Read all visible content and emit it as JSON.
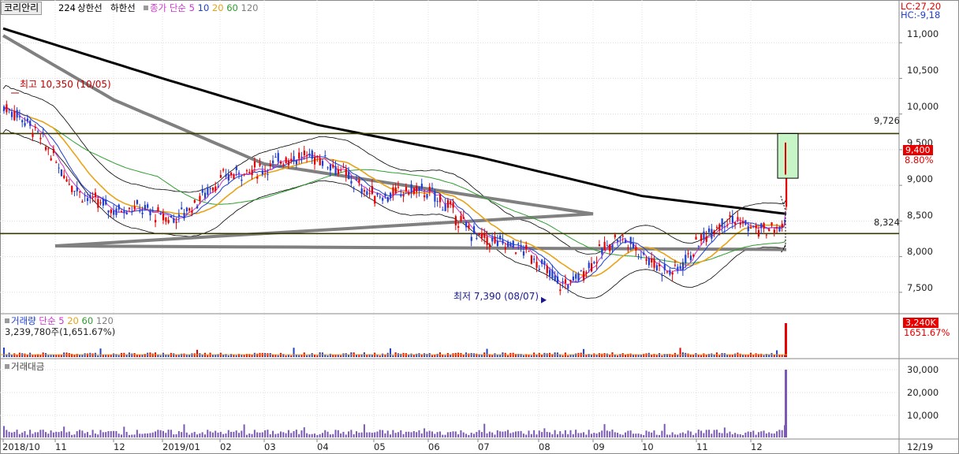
{
  "header": {
    "stock_name": "코리안리",
    "count": "224",
    "upper_limit": "상한선",
    "lower_limit": "하한선",
    "ma_prefix": "종가 단순",
    "ma_periods": [
      "5",
      "10",
      "20",
      "60",
      "120"
    ],
    "lc": "LC:27,20",
    "hc": "HC:-9,18"
  },
  "price_panel": {
    "high_label": "최고 10,350 (10/05)",
    "low_label": "최저 7,390 (08/07)",
    "resistance_label": "9,726",
    "support_label": "8,324",
    "current_price": "9,400",
    "current_change": "8.80%",
    "axis_ticks": [
      "11,000",
      "10,500",
      "10,000",
      "9,500",
      "9,000",
      "8,500",
      "8,000",
      "7,500"
    ]
  },
  "volume_panel": {
    "title": "거래량",
    "ma_prefix": "단순",
    "ma_periods": [
      "5",
      "20",
      "60",
      "120"
    ],
    "last_value": "3,239,780주(1,651.67%)",
    "current_badge": "3,240K",
    "current_pct": "1651.67%"
  },
  "amount_panel": {
    "title": "거래대금",
    "axis_ticks": [
      "30,000",
      "20,000",
      "10,000"
    ]
  },
  "x_axis": {
    "labels": [
      "2018/10",
      "11",
      "12",
      "2019/01",
      "02",
      "03",
      "04",
      "05",
      "06",
      "07",
      "08",
      "09",
      "10",
      "11",
      "12"
    ],
    "last_date": "12/19"
  },
  "colors": {
    "up": "#e60000",
    "down": "#1f3fcf",
    "ma5": "#cc33cc",
    "ma10": "#1f3fcf",
    "ma20": "#e8a317",
    "ma60": "#2e9e2e",
    "ma120": "#808080",
    "ma224": "#000000",
    "band": "#000000",
    "hline": "#3a3a00"
  },
  "chart_data": {
    "type": "candlestick",
    "period": "daily",
    "x_range": [
      "2018/10",
      "12/19"
    ],
    "ylim": [
      7200,
      11400
    ],
    "yticks": [
      7500,
      8000,
      8500,
      9000,
      9500,
      10000,
      10500,
      11000
    ],
    "grid": true,
    "close_series": [
      {
        "date": "2018/10",
        "close": 10100
      },
      {
        "date": "11",
        "close": 9300
      },
      {
        "date": "12",
        "close": 8550
      },
      {
        "date": "2019/01",
        "close": 8650
      },
      {
        "date": "02",
        "close": 9000
      },
      {
        "date": "03",
        "close": 9500
      },
      {
        "date": "04",
        "close": 9150
      },
      {
        "date": "05",
        "close": 8900
      },
      {
        "date": "06",
        "close": 8700
      },
      {
        "date": "07",
        "close": 8100
      },
      {
        "date": "08",
        "close": 7700
      },
      {
        "date": "09",
        "close": 8150
      },
      {
        "date": "10",
        "close": 7900
      },
      {
        "date": "11",
        "close": 8450
      },
      {
        "date": "12",
        "close": 8500
      },
      {
        "date": "12/19",
        "close": 9400
      }
    ],
    "moving_average_224": [
      {
        "date": "2018/10",
        "value": 11200
      },
      {
        "date": "2019/01",
        "value": 10500
      },
      {
        "date": "04",
        "value": 9850
      },
      {
        "date": "07",
        "value": 9400
      },
      {
        "date": "10",
        "value": 8850
      },
      {
        "date": "12/19",
        "value": 8600
      }
    ],
    "moving_average_120": [
      {
        "date": "2018/10",
        "value": 11100
      },
      {
        "date": "12",
        "value": 10200
      },
      {
        "date": "03",
        "value": 9300
      },
      {
        "date": "06",
        "value": 8950
      },
      {
        "date": "09",
        "value": 8600
      },
      {
        "date": "11",
        "value": 8150
      },
      {
        "date": "12/19",
        "value": 8100
      }
    ],
    "horizontal_lines": [
      9726,
      8324
    ],
    "high": {
      "value": 10350,
      "date": "10/05"
    },
    "low": {
      "value": 7390,
      "date": "08/07"
    },
    "last": {
      "value": 9400,
      "change_pct": 8.8
    },
    "volume": {
      "last": 3239780,
      "last_pct": 1651.67
    },
    "amount_yticks": [
      10000,
      20000,
      30000
    ]
  }
}
